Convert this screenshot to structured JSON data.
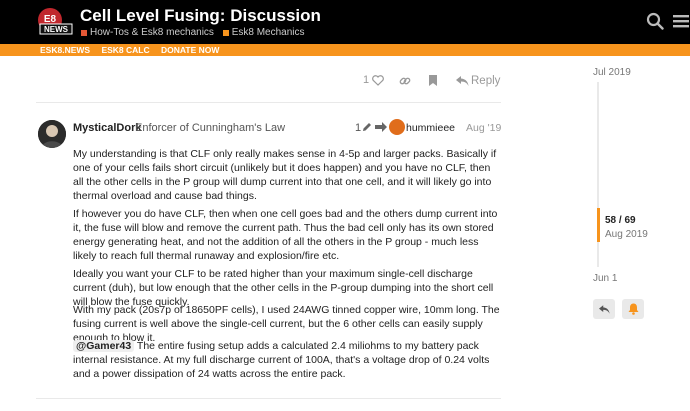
{
  "header": {
    "title": "Cell Level Fusing: Discussion",
    "categories": [
      {
        "label": "How-Tos & Esk8 mechanics",
        "color": "#e45735"
      },
      {
        "label": "Esk8 Mechanics",
        "color": "#f7941d"
      }
    ],
    "logo_text": "NEWS"
  },
  "nav": [
    "ESK8.NEWS",
    "ESK8 CALC",
    "DONATE NOW"
  ],
  "prev_post_actions": {
    "like_count": "1",
    "reply_label": "Reply"
  },
  "post": {
    "username": "MysticalDork",
    "user_title": "Enforcer of Cunningham's Law",
    "edit_count": "1",
    "reply_to": "hummieee",
    "date": "Aug '19",
    "paragraphs": [
      "My understanding is that CLF only really makes sense in 4-5p and larger packs. Basically if one of your cells fails short circuit (unlikely but it does happen) and you have no CLF, then all the other cells in the P group will dump current into that one cell, and it will likely go into thermal overload and cause bad things.",
      "If however you do have CLF, then when one cell goes bad and the others dump current into it, the fuse will blow and remove the current path. Thus the bad cell only has its own stored energy generating heat, and not the addition of all the others in the P group - much less likely to reach full thermal runaway and explosion/fire etc.",
      "Ideally you want your CLF to be rated higher than your maximum single-cell discharge current (duh), but low enough that the other cells in the P-group dumping into the short cell will blow the fuse quickly.",
      "With my pack (20s7p of 18650PF cells), I used 24AWG tinned copper wire, 10mm long. The fusing current is well above the single-cell current, but the 6 other cells can easily supply enough to blow it."
    ],
    "mention": "@Gamer43",
    "last_paragraph": " The entire fusing setup adds a calculated 2.4 miliohms to my battery pack internal resistance. At my full discharge current of 100A, that's a voltage drop of 0.24 volts and a power dissipation of 24 watts across the entire pack."
  },
  "timeline": {
    "start": "Jul 2019",
    "position": "58 / 69",
    "position_date": "Aug 2019",
    "end": "Jun 1"
  },
  "colors": {
    "accent": "#f7941d",
    "header_bg": "#000000"
  }
}
